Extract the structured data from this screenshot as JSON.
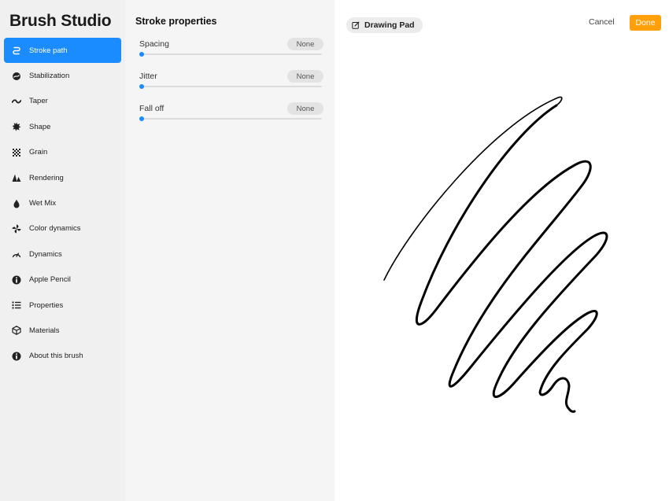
{
  "sidebar": {
    "title": "Brush Studio",
    "accent_color": "#1a8cff",
    "items": [
      {
        "label": "Stroke path",
        "icon": "stroke-path-icon",
        "active": true
      },
      {
        "label": "Stabilization",
        "icon": "stabilization-icon",
        "active": false
      },
      {
        "label": "Taper",
        "icon": "taper-icon",
        "active": false
      },
      {
        "label": "Shape",
        "icon": "shape-icon",
        "active": false
      },
      {
        "label": "Grain",
        "icon": "grain-icon",
        "active": false
      },
      {
        "label": "Rendering",
        "icon": "rendering-icon",
        "active": false
      },
      {
        "label": "Wet Mix",
        "icon": "wet-mix-icon",
        "active": false
      },
      {
        "label": "Color dynamics",
        "icon": "color-dynamics-icon",
        "active": false
      },
      {
        "label": "Dynamics",
        "icon": "dynamics-icon",
        "active": false
      },
      {
        "label": "Apple Pencil",
        "icon": "apple-pencil-icon",
        "active": false
      },
      {
        "label": "Properties",
        "icon": "properties-icon",
        "active": false
      },
      {
        "label": "Materials",
        "icon": "materials-icon",
        "active": false
      },
      {
        "label": "About this brush",
        "icon": "info-icon",
        "active": false
      }
    ]
  },
  "panel": {
    "title": "Stroke properties",
    "properties": [
      {
        "label": "Spacing",
        "value": "None",
        "level": 0
      },
      {
        "label": "Jitter",
        "value": "None",
        "level": 0
      },
      {
        "label": "Fall off",
        "value": "None",
        "level": 0
      }
    ]
  },
  "canvas": {
    "pad_label": "Drawing Pad",
    "pad_icon": "edit-icon",
    "cancel_label": "Cancel",
    "done_label": "Done",
    "done_color": "#ff9f0a",
    "stroke_color": "#000000"
  }
}
